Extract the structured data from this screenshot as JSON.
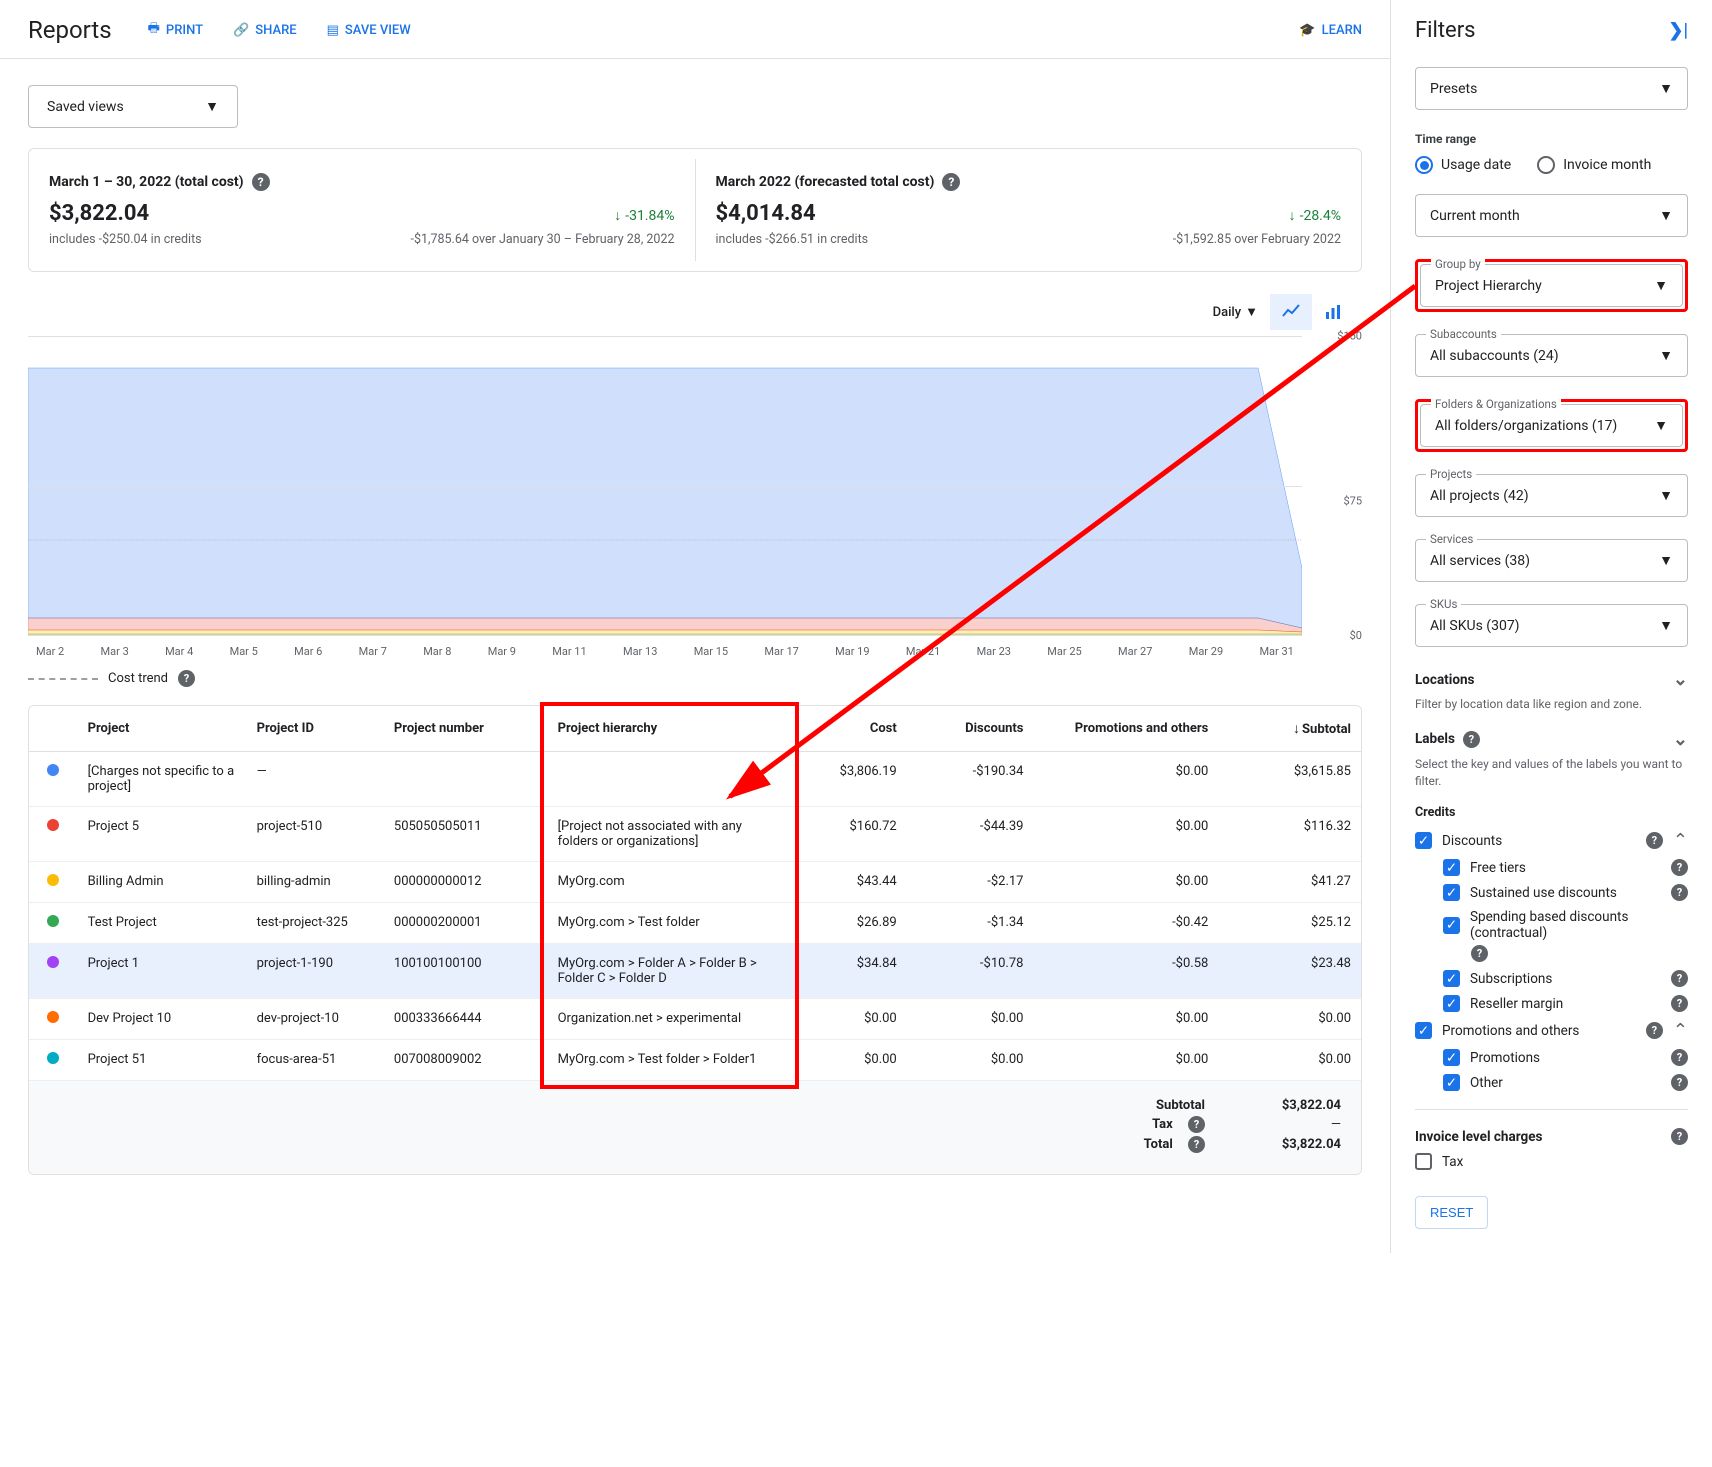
{
  "header": {
    "title": "Reports",
    "actions": {
      "print": "PRINT",
      "share": "SHARE",
      "save_view": "SAVE VIEW"
    },
    "learn": "LEARN"
  },
  "saved_views_label": "Saved views",
  "summary": {
    "left": {
      "title": "March 1 – 30, 2022 (total cost)",
      "amount": "$3,822.04",
      "includes": "includes -$250.04 in credits",
      "pct": "-31.84%",
      "compare": "-$1,785.64 over January 30 – February 28, 2022"
    },
    "right": {
      "title": "March 2022 (forecasted total cost)",
      "amount": "$4,014.84",
      "includes": "includes -$266.51 in credits",
      "pct": "-28.4%",
      "compare": "-$1,592.85 over February 2022"
    }
  },
  "chart_controls": {
    "granularity": "Daily"
  },
  "chart_data": {
    "type": "area",
    "xlabel": "",
    "ylabel": "",
    "ylim": [
      0,
      150
    ],
    "yticks": [
      "$0",
      "$75",
      "$150"
    ],
    "x_labels": [
      "Mar 2",
      "Mar 3",
      "Mar 4",
      "Mar 5",
      "Mar 6",
      "Mar 7",
      "Mar 8",
      "Mar 9",
      "Mar 11",
      "Mar 13",
      "Mar 15",
      "Mar 17",
      "Mar 19",
      "Mar 21",
      "Mar 23",
      "Mar 25",
      "Mar 27",
      "Mar 29",
      "Mar 31"
    ],
    "series": [
      {
        "name": "[Charges not specific to a project]",
        "color": "#4285f4",
        "values": [
          125,
          125,
          125,
          125,
          125,
          125,
          125,
          125,
          125,
          125,
          125,
          125,
          125,
          125,
          125,
          125,
          125,
          125,
          125,
          125,
          125,
          125,
          125,
          125,
          125,
          125,
          125,
          125,
          125,
          30
        ]
      },
      {
        "name": "Project 5",
        "color": "#ea4335",
        "values": [
          6,
          6,
          6,
          6,
          6,
          6,
          6,
          6,
          6,
          6,
          6,
          6,
          6,
          6,
          6,
          6,
          6,
          6,
          6,
          6,
          6,
          6,
          6,
          6,
          6,
          6,
          6,
          6,
          6,
          2
        ]
      },
      {
        "name": "Billing Admin",
        "color": "#fbbc04",
        "values": [
          2,
          2,
          2,
          2,
          2,
          2,
          2,
          2,
          2,
          2,
          2,
          2,
          2,
          2,
          2,
          2,
          2,
          2,
          2,
          2,
          2,
          2,
          2,
          2,
          2,
          2,
          2,
          2,
          2,
          1
        ]
      },
      {
        "name": "Test Project",
        "color": "#34a853",
        "values": [
          1,
          1,
          1,
          1,
          1,
          1,
          1,
          1,
          1,
          1,
          1,
          1,
          1,
          1,
          1,
          1,
          1,
          1,
          1,
          1,
          1,
          1,
          1,
          1,
          1,
          1,
          1,
          1,
          1,
          1
        ]
      }
    ],
    "trend_legend": "Cost trend"
  },
  "table": {
    "headers": {
      "project": "Project",
      "project_id": "Project ID",
      "project_number": "Project number",
      "hierarchy": "Project hierarchy",
      "cost": "Cost",
      "discounts": "Discounts",
      "promotions": "Promotions and others",
      "subtotal": "Subtotal"
    },
    "rows": [
      {
        "color": "#4285f4",
        "project": "[Charges not specific to a project]",
        "project_id": "—",
        "project_number": "",
        "hierarchy": "",
        "cost": "$3,806.19",
        "discounts": "-$190.34",
        "promotions": "$0.00",
        "subtotal": "$3,615.85",
        "selected": false
      },
      {
        "color": "#ea4335",
        "project": "Project 5",
        "project_id": "project-510",
        "project_number": "505050505011",
        "hierarchy": "[Project not associated with any folders or organizations]",
        "cost": "$160.72",
        "discounts": "-$44.39",
        "promotions": "$0.00",
        "subtotal": "$116.32",
        "selected": false
      },
      {
        "color": "#fbbc04",
        "project": "Billing Admin",
        "project_id": "billing-admin",
        "project_number": "000000000012",
        "hierarchy": "MyOrg.com",
        "cost": "$43.44",
        "discounts": "-$2.17",
        "promotions": "$0.00",
        "subtotal": "$41.27",
        "selected": false
      },
      {
        "color": "#34a853",
        "project": "Test Project",
        "project_id": "test-project-325",
        "project_number": "000000200001",
        "hierarchy": "MyOrg.com > Test folder",
        "cost": "$26.89",
        "discounts": "-$1.34",
        "promotions": "-$0.42",
        "subtotal": "$25.12",
        "selected": false
      },
      {
        "color": "#a142f4",
        "project": "Project 1",
        "project_id": "project-1-190",
        "project_number": "100100100100",
        "hierarchy": "MyOrg.com > Folder A > Folder B > Folder C > Folder D",
        "cost": "$34.84",
        "discounts": "-$10.78",
        "promotions": "-$0.58",
        "subtotal": "$23.48",
        "selected": true
      },
      {
        "color": "#ff6d01",
        "project": "Dev Project 10",
        "project_id": "dev-project-10",
        "project_number": "000333666444",
        "hierarchy": "Organization.net > experimental",
        "cost": "$0.00",
        "discounts": "$0.00",
        "promotions": "$0.00",
        "subtotal": "$0.00",
        "selected": false
      },
      {
        "color": "#00acc1",
        "project": "Project 51",
        "project_id": "focus-area-51",
        "project_number": "007008009002",
        "hierarchy": "MyOrg.com > Test folder > Folder1",
        "cost": "$0.00",
        "discounts": "$0.00",
        "promotions": "$0.00",
        "subtotal": "$0.00",
        "selected": false
      }
    ],
    "footer": {
      "subtotal_label": "Subtotal",
      "subtotal_val": "$3,822.04",
      "tax_label": "Tax",
      "tax_val": "—",
      "total_label": "Total",
      "total_val": "$3,822.04"
    }
  },
  "filters": {
    "title": "Filters",
    "presets": "Presets",
    "time_range_label": "Time range",
    "usage_date": "Usage date",
    "invoice_month": "Invoice month",
    "time_value": "Current month",
    "group_by_label": "Group by",
    "group_by_value": "Project Hierarchy",
    "subaccounts_label": "Subaccounts",
    "subaccounts_value": "All subaccounts (24)",
    "folders_label": "Folders & Organizations",
    "folders_value": "All folders/organizations (17)",
    "projects_label": "Projects",
    "projects_value": "All projects (42)",
    "services_label": "Services",
    "services_value": "All services (38)",
    "skus_label": "SKUs",
    "skus_value": "All SKUs (307)",
    "locations_label": "Locations",
    "locations_sub": "Filter by location data like region and zone.",
    "labels_label": "Labels",
    "labels_sub": "Select the key and values of the labels you want to filter.",
    "credits_label": "Credits",
    "discounts_label": "Discounts",
    "free_tiers": "Free tiers",
    "sustained": "Sustained use discounts",
    "spending": "Spending based discounts (contractual)",
    "subscriptions": "Subscriptions",
    "reseller": "Reseller margin",
    "promos_label": "Promotions and others",
    "promotions": "Promotions",
    "other": "Other",
    "invoice_charges_label": "Invoice level charges",
    "tax": "Tax",
    "reset": "RESET"
  }
}
